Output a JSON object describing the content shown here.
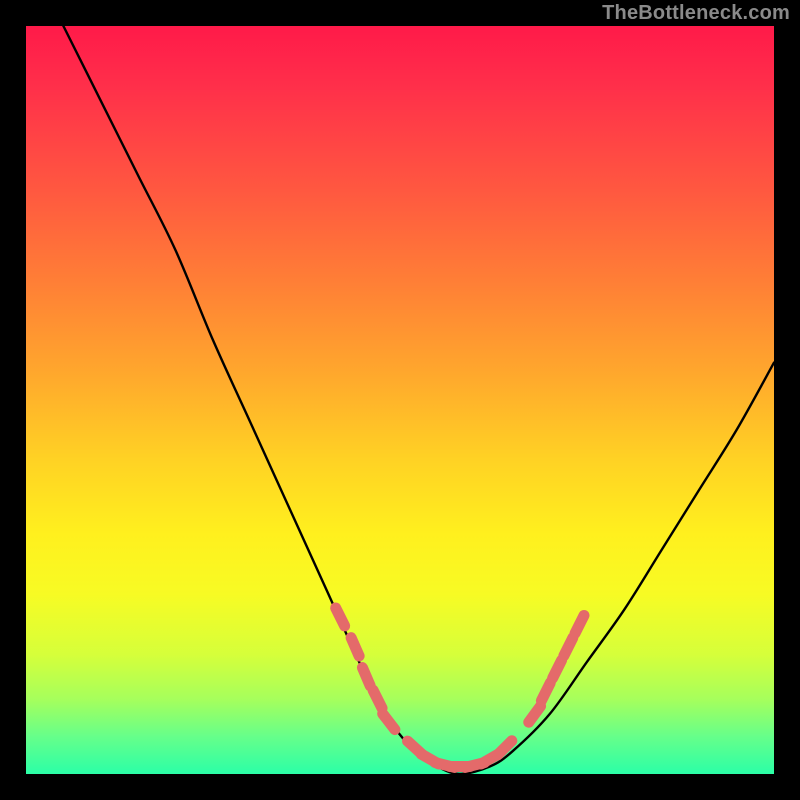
{
  "watermark": "TheBottleneck.com",
  "chart_data": {
    "type": "line",
    "title": "",
    "xlabel": "",
    "ylabel": "",
    "xlim": [
      0,
      100
    ],
    "ylim": [
      0,
      100
    ],
    "grid": false,
    "legend": false,
    "series": [
      {
        "name": "curve",
        "x": [
          5,
          10,
          15,
          20,
          25,
          30,
          35,
          40,
          45,
          48,
          52,
          55,
          58,
          62,
          65,
          70,
          75,
          80,
          85,
          90,
          95,
          100
        ],
        "y": [
          100,
          90,
          80,
          70,
          58,
          47,
          36,
          25,
          14,
          8,
          3,
          1,
          0,
          1,
          3,
          8,
          15,
          22,
          30,
          38,
          46,
          55
        ]
      }
    ],
    "highlights": {
      "name": "markers",
      "color": "#e46a6a",
      "points": [
        {
          "x": 42,
          "y": 21
        },
        {
          "x": 44,
          "y": 17
        },
        {
          "x": 45.5,
          "y": 13
        },
        {
          "x": 47,
          "y": 10
        },
        {
          "x": 48.5,
          "y": 7
        },
        {
          "x": 52,
          "y": 3.5
        },
        {
          "x": 54,
          "y": 2
        },
        {
          "x": 56,
          "y": 1.2
        },
        {
          "x": 58,
          "y": 1
        },
        {
          "x": 60,
          "y": 1.2
        },
        {
          "x": 62,
          "y": 2
        },
        {
          "x": 64,
          "y": 3.5
        },
        {
          "x": 68,
          "y": 8
        },
        {
          "x": 69.5,
          "y": 11
        },
        {
          "x": 71,
          "y": 14
        },
        {
          "x": 72.5,
          "y": 17
        },
        {
          "x": 74,
          "y": 20
        }
      ]
    }
  }
}
